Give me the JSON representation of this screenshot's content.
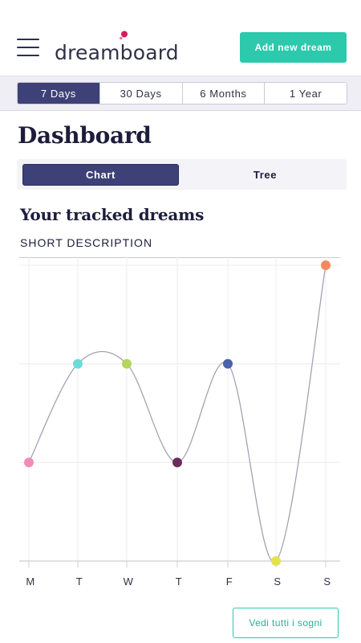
{
  "header": {
    "menu_icon": "hamburger-menu-icon",
    "logo_text": "dreamboard",
    "logo_dot_colors": [
      "#d81b60",
      "#e57aa1"
    ],
    "add_button_label": "Add new dream",
    "accent_color": "#2dc9ad"
  },
  "range_tabs": [
    {
      "label": "7 Days",
      "active": true
    },
    {
      "label": "30 Days",
      "active": false
    },
    {
      "label": "6 Months",
      "active": false
    },
    {
      "label": "1 Year",
      "active": false
    }
  ],
  "page": {
    "title": "Dashboard"
  },
  "view_switch": {
    "chart_label": "Chart",
    "tree_label": "Tree",
    "active": "Chart"
  },
  "section": {
    "title": "Your tracked dreams",
    "subtitle": "SHORT DESCRIPTION"
  },
  "chart_data": {
    "type": "line",
    "categories": [
      "M",
      "T",
      "W",
      "T",
      "F",
      "S",
      "S"
    ],
    "values": [
      1,
      2,
      2,
      1,
      2,
      0,
      3
    ],
    "point_colors": [
      "#f28cb7",
      "#6cdcd8",
      "#b5d65a",
      "#6b2d5c",
      "#4a62ad",
      "#e6e14a",
      "#f38a5d"
    ],
    "ylim": [
      0,
      3
    ],
    "grid": true,
    "line_color": "#a3a3b3"
  },
  "footer": {
    "see_all_label": "Vedi tutti i sogni"
  }
}
